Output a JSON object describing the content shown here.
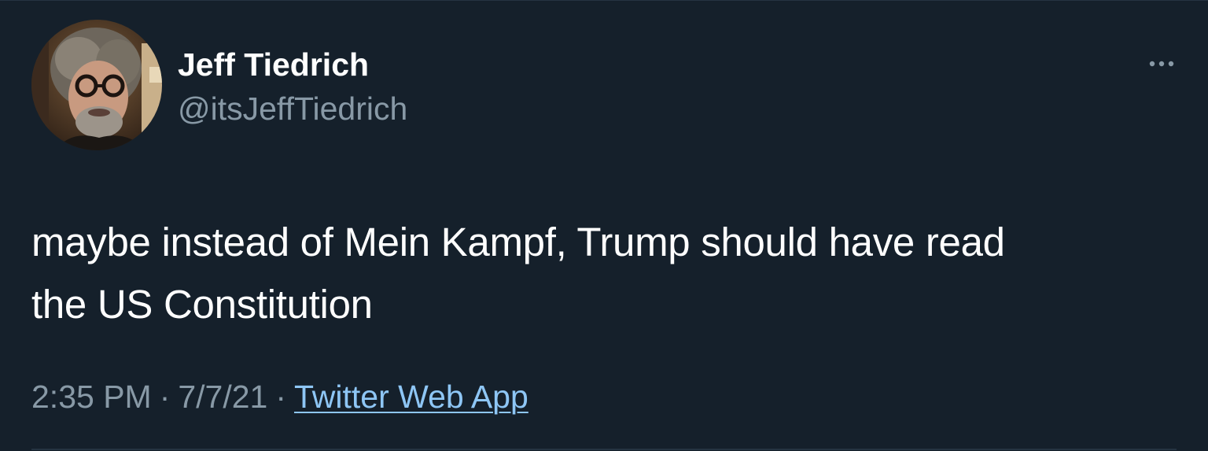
{
  "tweet": {
    "author": {
      "display_name": "Jeff Tiedrich",
      "handle": "@itsJeffTiedrich",
      "avatar_icon": "profile-photo"
    },
    "more_icon": "more-horizontal-icon",
    "text_line_1": "maybe instead of Mein Kampf, Trump should have read",
    "text_line_2": "the US Constitution",
    "time": "2:35 PM",
    "separator": "·",
    "date": "7/7/21",
    "source": "Twitter Web App"
  },
  "colors": {
    "background": "#15202b",
    "primary_text": "#ffffff",
    "secondary_text": "#8899a6",
    "link": "#8ec6f5"
  }
}
